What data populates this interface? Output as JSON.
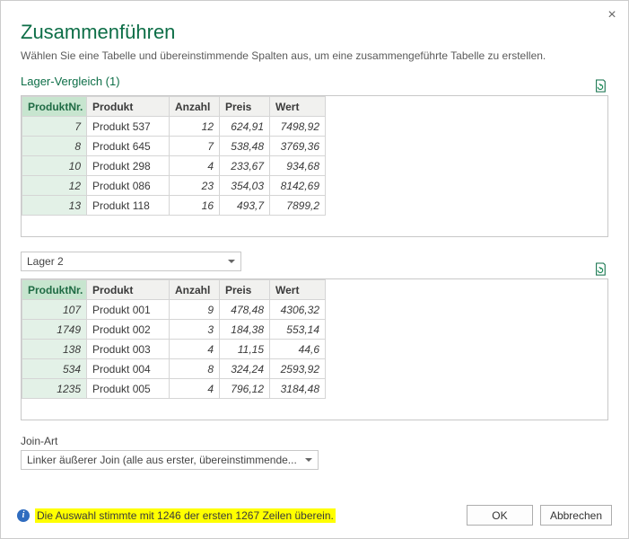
{
  "close": "×",
  "title": "Zusammenführen",
  "subtitle": "Wählen Sie eine Tabelle und übereinstimmende Spalten aus, um eine zusammengeführte Tabelle zu erstellen.",
  "table1": {
    "label": "Lager-Vergleich (1)",
    "headers": [
      "ProduktNr.",
      "Produkt",
      "Anzahl",
      "Preis",
      "Wert"
    ],
    "rows": [
      [
        "7",
        "Produkt 537",
        "12",
        "624,91",
        "7498,92"
      ],
      [
        "8",
        "Produkt 645",
        "7",
        "538,48",
        "3769,36"
      ],
      [
        "10",
        "Produkt 298",
        "4",
        "233,67",
        "934,68"
      ],
      [
        "12",
        "Produkt 086",
        "23",
        "354,03",
        "8142,69"
      ],
      [
        "13",
        "Produkt 118",
        "16",
        "493,7",
        "7899,2"
      ]
    ]
  },
  "table2": {
    "selectLabel": "Lager 2",
    "headers": [
      "ProduktNr.",
      "Produkt",
      "Anzahl",
      "Preis",
      "Wert"
    ],
    "rows": [
      [
        "107",
        "Produkt 001",
        "9",
        "478,48",
        "4306,32"
      ],
      [
        "1749",
        "Produkt 002",
        "3",
        "184,38",
        "553,14"
      ],
      [
        "138",
        "Produkt 003",
        "4",
        "11,15",
        "44,6"
      ],
      [
        "534",
        "Produkt 004",
        "8",
        "324,24",
        "2593,92"
      ],
      [
        "1235",
        "Produkt 005",
        "4",
        "796,12",
        "3184,48"
      ]
    ]
  },
  "joinLabel": "Join-Art",
  "joinSelect": "Linker äußerer Join (alle aus erster, übereinstimmende...",
  "infoText": "Die Auswahl stimmte mit 1246 der ersten 1267 Zeilen überein.",
  "ok": "OK",
  "cancel": "Abbrechen"
}
